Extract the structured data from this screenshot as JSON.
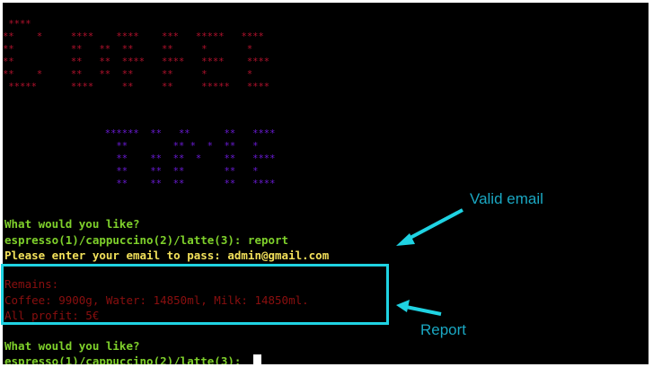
{
  "ascii_art": {
    "coffee": " ****\n**    *     ****    ****    ***   *****   ****\n**          **   **  **     **     *       *\n**          **   **  ****   ****   ****    ****\n**    *     **   **  **     **     *       *\n *****      ****     **     **     *****   ****",
    "time": "                  ******  **   **      **   ****\n                    **        ** *  *  **   *\n                    **    **  **  *    **   ****\n                    **    **  **       **   *\n                    **    **  **       **   ****"
  },
  "terminal": {
    "prompt1": "What would you like?",
    "menu1": "espresso(1)/cappuccino(2)/latte(3): report",
    "email_prompt": "Please enter your email to pass: admin@gmail.com",
    "remains_label": "Remains:",
    "remains_values": "Coffee: 9900g, Water: 14850ml, Milk: 14850ml.",
    "profit": "All profit: 5€",
    "prompt2": "What would you like?",
    "menu2": "espresso(1)/cappuccino(2)/latte(3): "
  },
  "annotations": {
    "valid_email": "Valid email",
    "report": "Report"
  },
  "colors": {
    "background": "#000000",
    "prompt_green": "#7fd12b",
    "email_yellow": "#f2e05a",
    "report_red": "#8a0f0f",
    "coffee_art_red": "#b3122d",
    "time_art_purple": "#6a1bd6",
    "annotation_cyan": "#1fd3e3"
  }
}
